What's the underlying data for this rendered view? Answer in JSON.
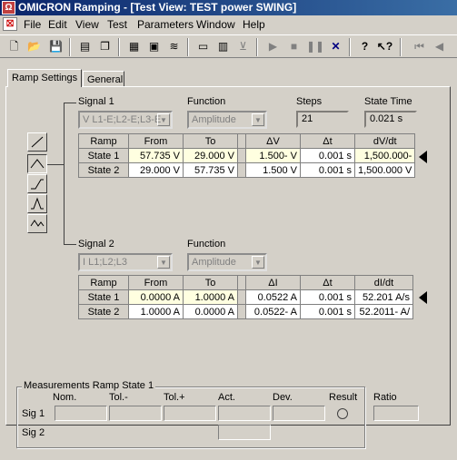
{
  "window": {
    "title": "OMICRON Ramping - [Test View: TEST power SWING]",
    "app_icon": "omicron-icon"
  },
  "menu": [
    "File",
    "Edit",
    "View",
    "Test",
    "Parameters",
    "Window",
    "Help"
  ],
  "tabs": [
    {
      "label": "Ramp Settings",
      "active": true
    },
    {
      "label": "General",
      "active": false
    }
  ],
  "signal1": {
    "label": "Signal 1",
    "signal_value": "V L1-E;L2-E;L3-E",
    "function_label": "Function",
    "function_value": "Amplitude",
    "steps_label": "Steps",
    "steps_value": "21",
    "state_time_label": "State Time",
    "state_time_value": "0.021 s",
    "headers": [
      "Ramp",
      "From",
      "To",
      "ΔV",
      "Δt",
      "dV/dt"
    ],
    "rows": [
      {
        "state": "State 1",
        "from": "57.735 V",
        "to": "29.000 V",
        "delta": "1.500- V",
        "dt": "0.001 s",
        "rate": "1,500.000-"
      },
      {
        "state": "State 2",
        "from": "29.000 V",
        "to": "57.735 V",
        "delta": "1.500 V",
        "dt": "0.001 s",
        "rate": "1,500.000 V"
      }
    ]
  },
  "signal2": {
    "label": "Signal 2",
    "signal_value": "I L1;L2;L3",
    "function_label": "Function",
    "function_value": "Amplitude",
    "headers": [
      "Ramp",
      "From",
      "To",
      "ΔI",
      "Δt",
      "dI/dt"
    ],
    "rows": [
      {
        "state": "State 1",
        "from": "0.0000 A",
        "to": "1.0000 A",
        "delta": "0.0522 A",
        "dt": "0.001 s",
        "rate": "52.201 A/s"
      },
      {
        "state": "State 2",
        "from": "1.0000 A",
        "to": "0.0000 A",
        "delta": "0.0522- A",
        "dt": "0.001 s",
        "rate": "52.2011- A/"
      }
    ]
  },
  "measurements": {
    "title": "Measurements Ramp State 1",
    "columns": [
      "Nom.",
      "Tol.-",
      "Tol.+",
      "Act.",
      "Dev.",
      "Result"
    ],
    "rows": [
      "Sig 1",
      "Sig 2"
    ],
    "ratio_label": "Ratio"
  }
}
